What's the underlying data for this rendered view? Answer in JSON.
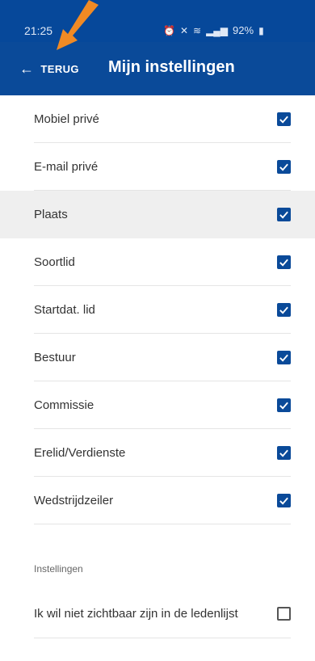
{
  "status_bar": {
    "time": "21:25",
    "battery": "92%"
  },
  "header": {
    "back_label": "TERUG",
    "title": "Mijn instellingen"
  },
  "settings": [
    {
      "label": "Mobiel privé",
      "checked": true
    },
    {
      "label": "E-mail privé",
      "checked": true
    },
    {
      "label": "Plaats",
      "checked": true,
      "highlighted": true
    },
    {
      "label": "Soortlid",
      "checked": true
    },
    {
      "label": "Startdat. lid",
      "checked": true
    },
    {
      "label": "Bestuur",
      "checked": true
    },
    {
      "label": "Commissie",
      "checked": true
    },
    {
      "label": "Erelid/Verdienste",
      "checked": true
    },
    {
      "label": "Wedstrijdzeiler",
      "checked": true
    }
  ],
  "instellingen_section": {
    "label": "Instellingen",
    "option": {
      "label": "Ik wil niet zichtbaar zijn in de ledenlijst",
      "checked": false
    }
  },
  "colors": {
    "header_bg": "#0a4a99",
    "accent": "#0a4a99",
    "annotation": "#f08a24"
  },
  "icons": {
    "back": "arrow-left-icon",
    "checkbox_checked": "check-icon",
    "annotation": "orange-pointer-arrow-icon"
  }
}
